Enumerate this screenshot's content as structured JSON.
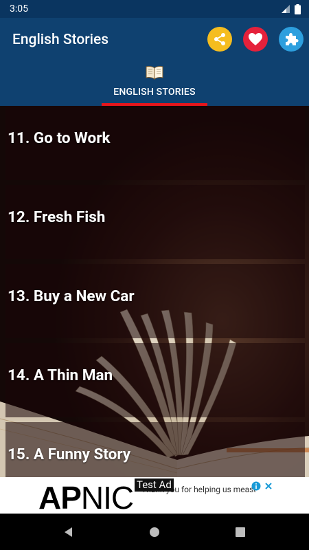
{
  "status_bar": {
    "time": "3:05"
  },
  "app_bar": {
    "title": "English Stories",
    "colors": {
      "share": "#f5bd1f",
      "favorite": "#e5213b",
      "more": "#2d9fde"
    }
  },
  "tabs": [
    {
      "label": "ENGLISH STORIES",
      "icon": "open-book-icon",
      "selected": true
    }
  ],
  "stories": [
    {
      "label": "11. Go to Work"
    },
    {
      "label": "12. Fresh Fish"
    },
    {
      "label": "13. Buy a New Car"
    },
    {
      "label": "14. A Thin Man"
    },
    {
      "label": "15. A Funny Story"
    }
  ],
  "ad": {
    "brand_bold": "AP",
    "brand_light": "NIC",
    "badge": "Test Ad",
    "text": "Thank you for helping us measure the Internet."
  }
}
